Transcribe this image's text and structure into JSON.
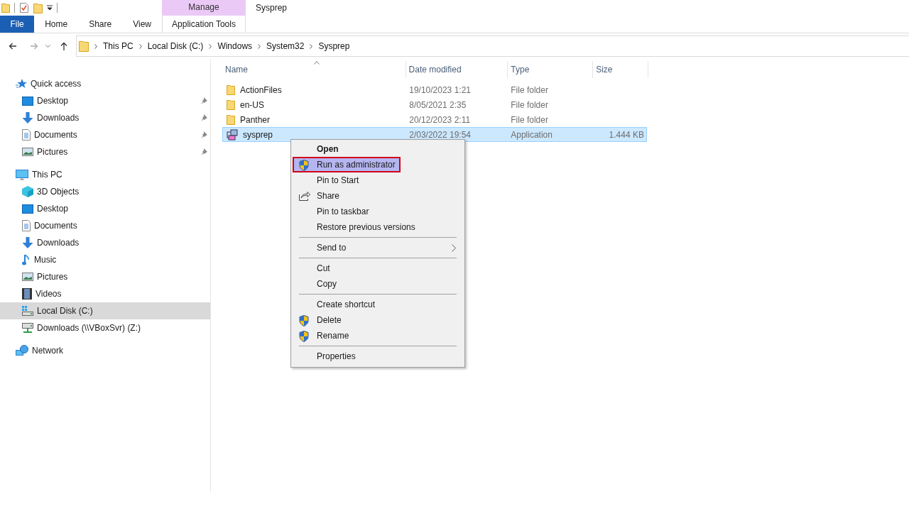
{
  "window": {
    "title": "Sysprep"
  },
  "ribbon": {
    "tabs": [
      {
        "label": "File",
        "kind": "file",
        "selected": false
      },
      {
        "label": "Home",
        "kind": "tab",
        "selected": false
      },
      {
        "label": "Share",
        "kind": "tab",
        "selected": false
      },
      {
        "label": "View",
        "kind": "tab",
        "selected": false
      }
    ],
    "contextual": {
      "header": "Manage",
      "tabs": [
        {
          "label": "Application Tools",
          "selected": true
        }
      ]
    }
  },
  "address_bar": {
    "breadcrumbs": [
      "This PC",
      "Local Disk (C:)",
      "Windows",
      "System32",
      "Sysprep"
    ]
  },
  "navigation_pane": {
    "groups": [
      {
        "label": "Quick access",
        "kind": "quick",
        "selected": false,
        "children": [
          {
            "label": "Desktop",
            "kind": "desktop",
            "pinned": true,
            "selected": false
          },
          {
            "label": "Downloads",
            "kind": "downloads",
            "pinned": true,
            "selected": false
          },
          {
            "label": "Documents",
            "kind": "documents",
            "pinned": true,
            "selected": false
          },
          {
            "label": "Pictures",
            "kind": "pictures",
            "pinned": true,
            "selected": false
          }
        ]
      },
      {
        "label": "This PC",
        "kind": "pc",
        "selected": false,
        "children": [
          {
            "label": "3D Objects",
            "kind": "objects",
            "selected": false
          },
          {
            "label": "Desktop",
            "kind": "desktop",
            "selected": false
          },
          {
            "label": "Documents",
            "kind": "documents",
            "selected": false
          },
          {
            "label": "Downloads",
            "kind": "downloads",
            "selected": false
          },
          {
            "label": "Music",
            "kind": "music",
            "selected": false
          },
          {
            "label": "Pictures",
            "kind": "pictures",
            "selected": false
          },
          {
            "label": "Videos",
            "kind": "videos",
            "selected": false
          },
          {
            "label": "Local Disk (C:)",
            "kind": "drive",
            "selected": true
          },
          {
            "label": "Downloads (\\\\VBoxSvr) (Z:)",
            "kind": "netdrive",
            "selected": false
          }
        ]
      },
      {
        "label": "Network",
        "kind": "network",
        "selected": false
      }
    ]
  },
  "file_list": {
    "columns": [
      {
        "label": "Name",
        "sorted": true
      },
      {
        "label": "Date modified",
        "sorted": false
      },
      {
        "label": "Type",
        "sorted": false
      },
      {
        "label": "Size",
        "sorted": false
      }
    ],
    "rows": [
      {
        "name": "ActionFiles",
        "date": "19/10/2023 1:21",
        "type": "File folder",
        "kind": "folder",
        "selected": false
      },
      {
        "name": "en-US",
        "date": "8/05/2021 2:35",
        "type": "File folder",
        "kind": "folder",
        "selected": false
      },
      {
        "name": "Panther",
        "date": "20/12/2023 2:11",
        "type": "File folder",
        "kind": "folder",
        "selected": false
      },
      {
        "name": "sysprep",
        "date": "2/03/2022 19:54",
        "type": "Application",
        "size": "1.444 KB",
        "kind": "application",
        "selected": true
      }
    ]
  },
  "context_menu": {
    "items": [
      {
        "label": "Open",
        "kind": "default",
        "selected": false
      },
      {
        "label": "Run as administrator",
        "kind": "uac",
        "selected": true
      },
      {
        "label": "Pin to Start",
        "kind": "plain",
        "selected": false
      },
      {
        "label": "Share",
        "kind": "share",
        "selected": false
      },
      {
        "label": "Pin to taskbar",
        "kind": "plain",
        "selected": false
      },
      {
        "label": "Restore previous versions",
        "kind": "plain",
        "selected": false
      },
      {
        "kind": "separator"
      },
      {
        "label": "Send to",
        "kind": "submenu",
        "selected": false
      },
      {
        "kind": "separator"
      },
      {
        "label": "Cut",
        "kind": "plain",
        "selected": false
      },
      {
        "label": "Copy",
        "kind": "plain",
        "selected": false
      },
      {
        "kind": "separator"
      },
      {
        "label": "Create shortcut",
        "kind": "plain",
        "selected": false
      },
      {
        "label": "Delete",
        "kind": "uac",
        "selected": false
      },
      {
        "label": "Rename",
        "kind": "uac",
        "selected": false
      },
      {
        "kind": "separator"
      },
      {
        "label": "Properties",
        "kind": "plain",
        "selected": false
      }
    ]
  }
}
